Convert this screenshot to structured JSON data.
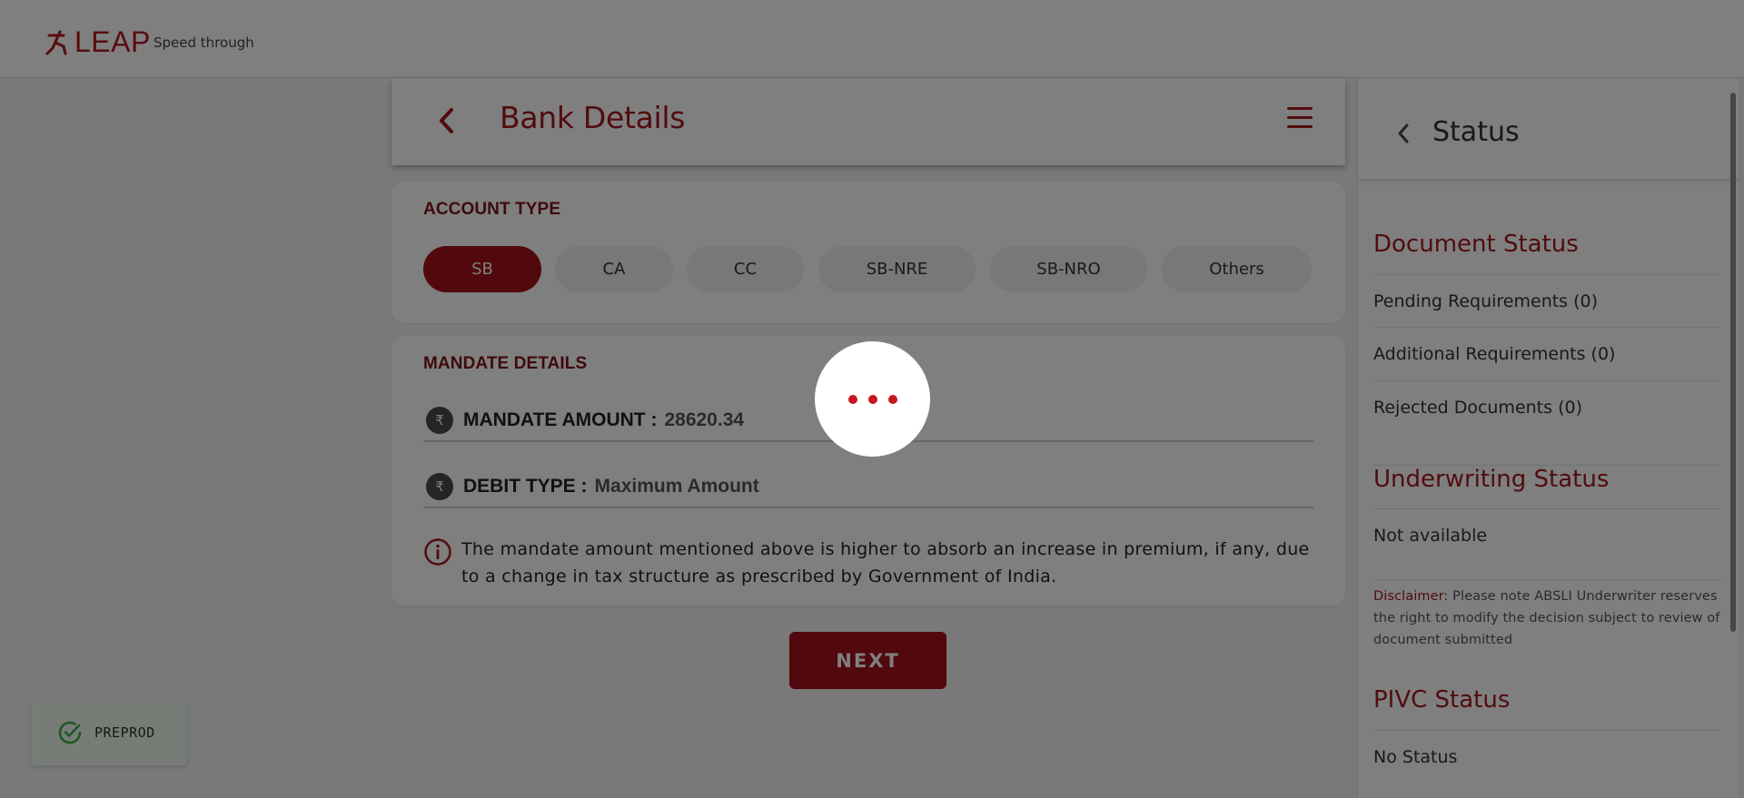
{
  "brand": {
    "logo_text": "LEAP",
    "tagline": "Speed through",
    "accent_color": "#a5181c"
  },
  "header": {
    "title": "Bank Details"
  },
  "account_type": {
    "heading": "ACCOUNT TYPE",
    "options": [
      "SB",
      "CA",
      "CC",
      "SB-NRE",
      "SB-NRO",
      "Others"
    ],
    "selected": "SB"
  },
  "mandate": {
    "heading": "MANDATE DETAILS",
    "amount_label": "MANDATE AMOUNT :",
    "amount_value": "28620.34",
    "debit_label": "DEBIT TYPE :",
    "debit_value": "Maximum Amount",
    "currency_symbol": "₹",
    "info_line1": "The mandate amount mentioned above is higher to absorb an increase in premium, if any, due",
    "info_line2": "to a change in tax structure as prescribed by Government of India."
  },
  "next_label": "NEXT",
  "status_panel": {
    "title": "Status",
    "document_status": {
      "title": "Document Status",
      "items": [
        "Pending Requirements (0)",
        "Additional Requirements (0)",
        "Rejected Documents (0)"
      ]
    },
    "underwriting_status": {
      "title": "Underwriting Status",
      "value": "Not available"
    },
    "disclaimer_label": "Disclaimer:",
    "disclaimer_text": " Please note ABSLI Underwriter reserves the right to modify the decision subject to review of document submitted",
    "pivc_status": {
      "title": "PIVC Status",
      "value": "No Status"
    }
  },
  "toast": {
    "text": "PREPROD"
  }
}
